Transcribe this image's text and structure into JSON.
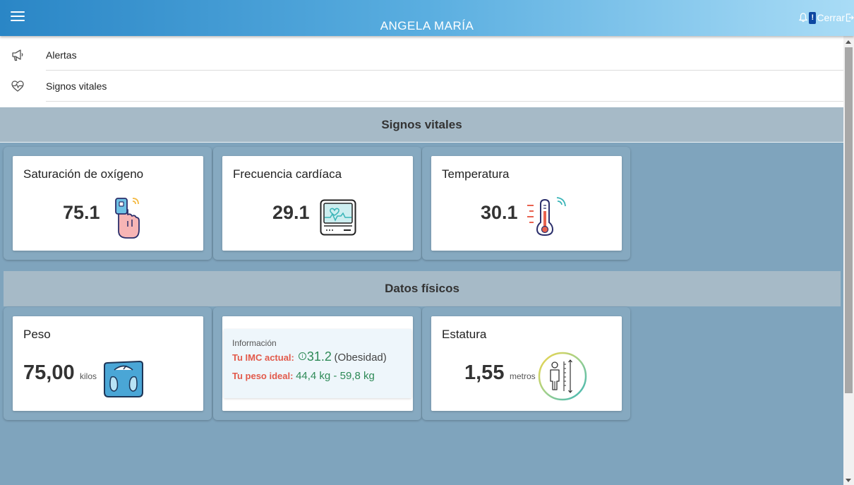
{
  "header": {
    "title": "ANGELA MARÍA",
    "badge": "!",
    "logout_label": "Cerrar"
  },
  "menu": {
    "items": [
      {
        "label": "Alertas",
        "icon": "megaphone-icon"
      },
      {
        "label": "Signos vitales",
        "icon": "heart-pulse-icon"
      }
    ]
  },
  "vitals": {
    "section_title": "Signos vitales",
    "oxygen": {
      "title": "Saturación de oxígeno",
      "value": "75.1",
      "icon": "pulse-oximeter-icon"
    },
    "heart": {
      "title": "Frecuencia cardíaca",
      "value": "29.1",
      "icon": "heart-monitor-icon"
    },
    "temperature": {
      "title": "Temperatura",
      "value": "30.1",
      "icon": "thermometer-icon"
    }
  },
  "physical": {
    "section_title": "Datos físicos",
    "weight": {
      "title": "Peso",
      "value": "75,00",
      "unit": "kilos",
      "icon": "scale-icon"
    },
    "info": {
      "heading": "Información",
      "imc_label": "Tu IMC actual:",
      "imc_value": "31.2",
      "imc_category": "(Obesidad)",
      "ideal_label": "Tu peso ideal:",
      "ideal_value": "44,4 kg - 59,8 kg"
    },
    "height": {
      "title": "Estatura",
      "value": "1,55",
      "unit": "metros",
      "icon": "height-meter-icon"
    }
  },
  "colors": {
    "header_start": "#2a86c6",
    "header_end": "#a9dcf6",
    "background": "#7fa4bd",
    "section_bar": "#a6bac7",
    "label_red": "#e25a4b",
    "value_green": "#2e8a57"
  }
}
